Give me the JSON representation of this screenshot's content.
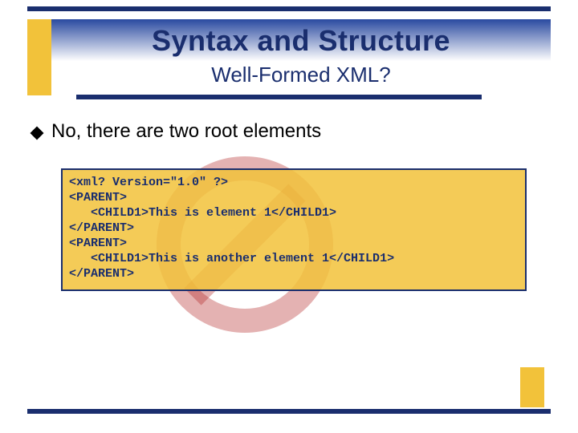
{
  "header": {
    "title": "Syntax and Structure",
    "subtitle": "Well-Formed XML?"
  },
  "bullet": {
    "text": "No, there are two root elements"
  },
  "code": {
    "line1": "<xml? Version=\"1.0\" ?>",
    "line2": "<PARENT>",
    "line3": "   <CHILD1>This is element 1</CHILD1>",
    "line4": "</PARENT>",
    "line5": "<PARENT>",
    "line6": "   <CHILD1>This is another element 1</CHILD1>",
    "line7": "</PARENT>"
  }
}
